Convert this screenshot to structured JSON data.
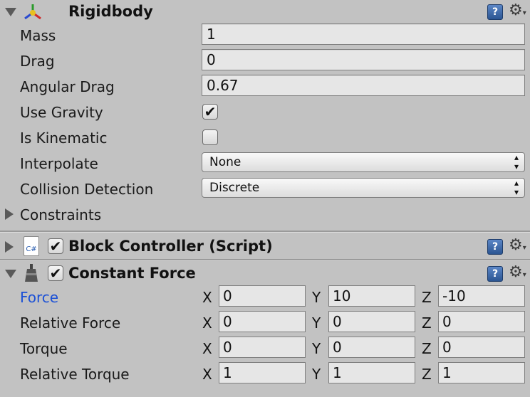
{
  "rigidbody": {
    "title": "Rigidbody",
    "fields": {
      "mass_label": "Mass",
      "mass_value": "1",
      "drag_label": "Drag",
      "drag_value": "0",
      "angular_drag_label": "Angular Drag",
      "angular_drag_value": "0.67",
      "use_gravity_label": "Use Gravity",
      "use_gravity_checked": true,
      "is_kinematic_label": "Is Kinematic",
      "is_kinematic_checked": false,
      "interpolate_label": "Interpolate",
      "interpolate_value": "None",
      "collision_label": "Collision Detection",
      "collision_value": "Discrete",
      "constraints_label": "Constraints"
    }
  },
  "block_controller": {
    "title": "Block Controller (Script)",
    "enabled": true
  },
  "constant_force": {
    "title": "Constant Force",
    "enabled": true,
    "axis_labels": {
      "x": "X",
      "y": "Y",
      "z": "Z"
    },
    "rows": [
      {
        "label": "Force",
        "x": "0",
        "y": "10",
        "z": "-10"
      },
      {
        "label": "Relative Force",
        "x": "0",
        "y": "0",
        "z": "0"
      },
      {
        "label": "Torque",
        "x": "0",
        "y": "0",
        "z": "0"
      },
      {
        "label": "Relative Torque",
        "x": "1",
        "y": "1",
        "z": "1"
      }
    ]
  },
  "icons": {
    "help": "help-book-icon",
    "settings": "gear-icon",
    "checkmark": "✔",
    "script": "C#"
  },
  "colors": {
    "panel_bg": "#c2c2c2",
    "highlight_label": "#1b50d6",
    "help_blue": "#3b6db0"
  }
}
